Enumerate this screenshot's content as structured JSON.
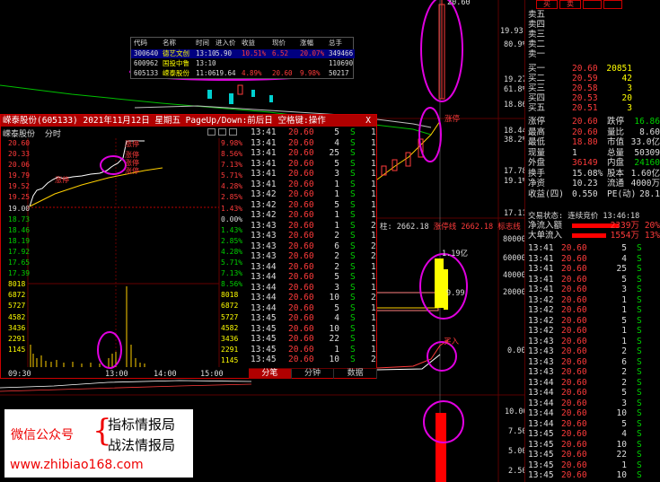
{
  "watchlist": {
    "headers": [
      "代码",
      "名称",
      "时间",
      "进入价",
      "收益",
      "现价",
      "涨幅",
      "总手"
    ],
    "rows": [
      [
        "300640",
        "德艺文创",
        "13:10",
        "5.90",
        "10.51%",
        "6.52",
        "20.07%",
        "349466"
      ],
      [
        "600962",
        "国投中鲁",
        "13:10",
        "",
        "",
        "",
        "",
        "110690"
      ],
      [
        "605133",
        "嵘泰股份",
        "11:06",
        "19.64",
        "4.89%",
        "20.60",
        "9.98%",
        "50217"
      ]
    ]
  },
  "popup": {
    "title": "嵘泰股份(605133) 2021年11月12日 星期五 PageUp/Down:前后日 空格键:操作",
    "close": "X",
    "name": "嵘泰股份",
    "mode": "分时",
    "price_left": [
      "20.60",
      "20.33",
      "20.06",
      "19.79",
      "19.52",
      "19.25",
      "19.00",
      "18.73",
      "18.46",
      "18.19",
      "17.92",
      "17.65",
      "17.39",
      "8018",
      "6872",
      "5727",
      "4582",
      "3436",
      "2291",
      "1145"
    ],
    "pct_right": [
      "9.98%",
      "8.56%",
      "7.13%",
      "5.71%",
      "4.28%",
      "2.85%",
      "1.43%",
      "0.00%",
      "1.43%",
      "2.85%",
      "4.28%",
      "5.71%",
      "7.13%",
      "8.56%",
      "8018",
      "6872",
      "5727",
      "4582",
      "3436",
      "2291",
      "1145"
    ],
    "times": [
      "09:30",
      "13:00",
      "14:00",
      "15:00"
    ],
    "labels": {
      "a": "涨停",
      "b": "涨停",
      "c": "涨停",
      "d": "涨停",
      "e": "涨停"
    },
    "tabs": [
      "分笔",
      "分钟",
      "数据"
    ],
    "trades": [
      [
        "13:41",
        "20.60",
        "5",
        "S",
        "1"
      ],
      [
        "13:41",
        "20.60",
        "4",
        "S",
        "1"
      ],
      [
        "13:41",
        "20.60",
        "25",
        "S",
        "1"
      ],
      [
        "13:41",
        "20.60",
        "5",
        "S",
        "1"
      ],
      [
        "13:41",
        "20.60",
        "3",
        "S",
        "1"
      ],
      [
        "13:41",
        "20.60",
        "1",
        "S",
        "1"
      ],
      [
        "13:42",
        "20.60",
        "1",
        "S",
        "1"
      ],
      [
        "13:42",
        "20.60",
        "5",
        "S",
        "1"
      ],
      [
        "13:42",
        "20.60",
        "1",
        "S",
        "1"
      ],
      [
        "13:43",
        "20.60",
        "1",
        "S",
        "2"
      ],
      [
        "13:43",
        "20.60",
        "2",
        "S",
        "1"
      ],
      [
        "13:43",
        "20.60",
        "6",
        "S",
        "2"
      ],
      [
        "13:43",
        "20.60",
        "2",
        "S",
        "2"
      ],
      [
        "13:44",
        "20.60",
        "2",
        "S",
        "1"
      ],
      [
        "13:44",
        "20.60",
        "5",
        "S",
        "1"
      ],
      [
        "13:44",
        "20.60",
        "3",
        "S",
        "1"
      ],
      [
        "13:44",
        "20.60",
        "10",
        "S",
        "2"
      ],
      [
        "13:44",
        "20.60",
        "5",
        "S",
        "1"
      ],
      [
        "13:45",
        "20.60",
        "4",
        "S",
        "1"
      ],
      [
        "13:45",
        "20.60",
        "10",
        "S",
        "1"
      ],
      [
        "13:45",
        "20.60",
        "22",
        "S",
        "1"
      ],
      [
        "13:45",
        "20.60",
        "1",
        "S",
        "1"
      ],
      [
        "13:45",
        "20.60",
        "10",
        "S",
        "2"
      ]
    ]
  },
  "main_axis": {
    "right_top": [
      "19.93",
      "80.9%",
      "19.27",
      "61.8%",
      "18.86",
      "18.44",
      "38.2%",
      "17.78",
      "19.1%",
      "17.11"
    ],
    "mid_title": "2662.18",
    "mid_label": "涨停线",
    "mid_label2": "标志线",
    "vol": [
      "80000",
      "60000",
      "40000",
      "20000",
      "0.00"
    ],
    "lower": [
      "10.00",
      "7.50",
      "5.00",
      "2.50"
    ],
    "small_labels": {
      "a": "1.19亿",
      "b": "9.99",
      "c": "涨停",
      "d": "买入"
    },
    "top_label": "20.60"
  },
  "right_panel": {
    "tabs": [
      "买",
      "卖",
      "",
      ""
    ],
    "asks": [
      [
        "卖五",
        "",
        ""
      ],
      [
        "卖四",
        "",
        ""
      ],
      [
        "卖三",
        "",
        ""
      ],
      [
        "卖二",
        "",
        ""
      ],
      [
        "卖一",
        "",
        ""
      ]
    ],
    "bids": [
      [
        "买一",
        "20.60",
        "20851"
      ],
      [
        "买二",
        "20.59",
        "42"
      ],
      [
        "买三",
        "20.58",
        "3"
      ],
      [
        "买四",
        "20.53",
        "20"
      ],
      [
        "买五",
        "20.51",
        "3"
      ]
    ],
    "stats": [
      [
        "涨停",
        "20.60",
        "跌停",
        "16.86"
      ],
      [
        "最高",
        "20.60",
        "量比",
        "8.60"
      ],
      [
        "最低",
        "18.80",
        "市值",
        "33.0亿"
      ],
      [
        "现量",
        "1",
        "总量",
        "50309"
      ],
      [
        "外盘",
        "36149",
        "内盘",
        "24160"
      ],
      [
        "换手",
        "15.08%",
        "股本",
        "1.60亿"
      ],
      [
        "净资",
        "10.23",
        "流通",
        "4000万"
      ],
      [
        "收益(四)",
        "0.550",
        "PE(动)",
        "28.1"
      ]
    ],
    "flow_title": "交易状态: 连续竞价 13:46:18",
    "flow": [
      [
        "净流入额",
        "2339万",
        "20%"
      ],
      [
        "大单流入",
        "1554万",
        "13%"
      ]
    ],
    "ticks": [
      [
        "13:41",
        "20.60",
        "5",
        "S"
      ],
      [
        "13:41",
        "20.60",
        "4",
        "S"
      ],
      [
        "13:41",
        "20.60",
        "25",
        "S"
      ],
      [
        "13:41",
        "20.60",
        "5",
        "S"
      ],
      [
        "13:41",
        "20.60",
        "3",
        "S"
      ],
      [
        "13:42",
        "20.60",
        "1",
        "S"
      ],
      [
        "13:42",
        "20.60",
        "1",
        "S"
      ],
      [
        "13:42",
        "20.60",
        "5",
        "S"
      ],
      [
        "13:42",
        "20.60",
        "1",
        "S"
      ],
      [
        "13:43",
        "20.60",
        "1",
        "S"
      ],
      [
        "13:43",
        "20.60",
        "2",
        "S"
      ],
      [
        "13:43",
        "20.60",
        "6",
        "S"
      ],
      [
        "13:43",
        "20.60",
        "2",
        "S"
      ],
      [
        "13:44",
        "20.60",
        "2",
        "S"
      ],
      [
        "13:44",
        "20.60",
        "5",
        "S"
      ],
      [
        "13:44",
        "20.60",
        "3",
        "S"
      ],
      [
        "13:44",
        "20.60",
        "10",
        "S"
      ],
      [
        "13:44",
        "20.60",
        "5",
        "S"
      ],
      [
        "13:45",
        "20.60",
        "4",
        "S"
      ],
      [
        "13:45",
        "20.60",
        "10",
        "S"
      ],
      [
        "13:45",
        "20.60",
        "22",
        "S"
      ],
      [
        "13:45",
        "20.60",
        "1",
        "S"
      ],
      [
        "13:45",
        "20.60",
        "10",
        "S"
      ]
    ]
  },
  "watermark": {
    "line1": "微信公众号",
    "line2": "指标情报局",
    "line3": "战法情报局",
    "url": "www.zhibiao168.com"
  }
}
